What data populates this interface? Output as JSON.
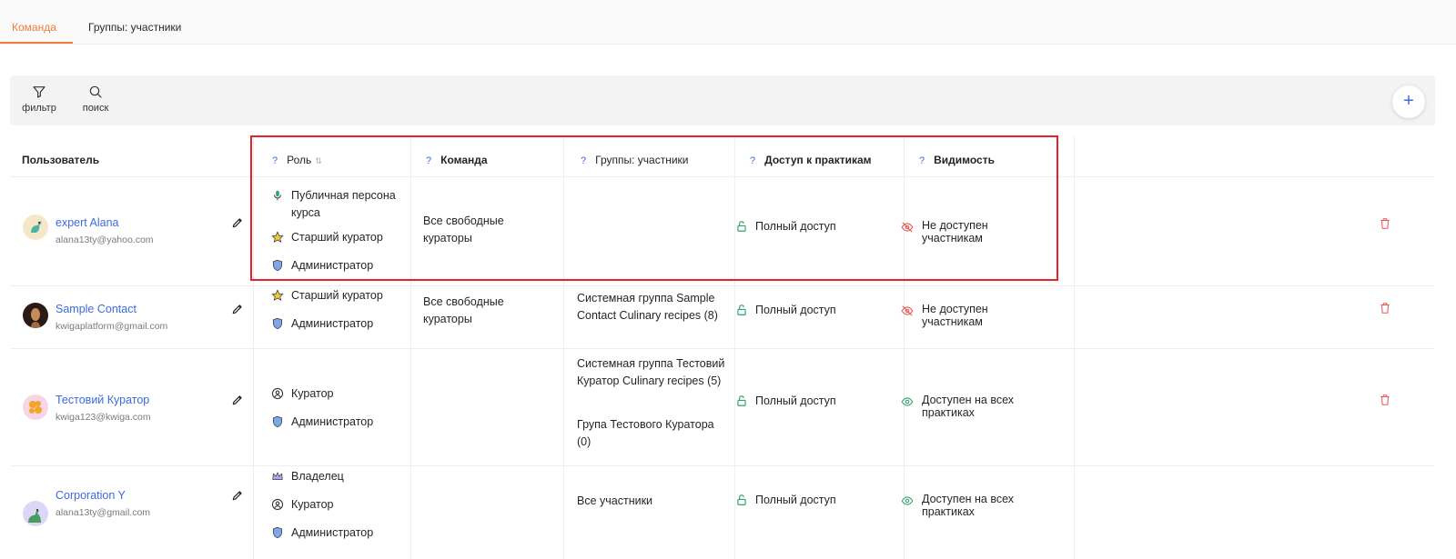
{
  "tabs": [
    {
      "label": "Команда",
      "active": true
    },
    {
      "label": "Группы: участники",
      "active": false
    }
  ],
  "toolbar": {
    "filter_label": "фильтр",
    "search_label": "поиск",
    "add_label": "+"
  },
  "table": {
    "headers": {
      "user": "Пользователь",
      "role": "Роль",
      "team": "Команда",
      "groups": "Группы: участники",
      "access": "Доступ к практикам",
      "visibility": "Видимость",
      "help": "?"
    },
    "rows": [
      {
        "name": "expert Alana",
        "email": "alana13ty@yahoo.com",
        "roles": [
          {
            "icon": "microphone-icon",
            "label": "Публичная персона курса"
          },
          {
            "icon": "star-icon",
            "label": "Старший куратор"
          },
          {
            "icon": "shield-icon",
            "label": "Администратор"
          }
        ],
        "team": "Все свободные кураторы",
        "groups": [],
        "access": "Полный доступ",
        "visibility": "Не доступен участникам",
        "visibility_icon": "eye-off-icon"
      },
      {
        "name": "Sample Contact",
        "email": "kwigaplatform@gmail.com",
        "roles": [
          {
            "icon": "star-icon",
            "label": "Старший куратор"
          },
          {
            "icon": "shield-icon",
            "label": "Администратор"
          }
        ],
        "team": "Все свободные кураторы",
        "groups": [
          "Системная группа Sample Contact Culinary recipes (8)"
        ],
        "access": "Полный доступ",
        "visibility": "Не доступен участникам",
        "visibility_icon": "eye-off-icon"
      },
      {
        "name": "Тестовий Куратор",
        "email": "kwiga123@kwiga.com",
        "roles": [
          {
            "icon": "user-circle-icon",
            "label": "Куратор"
          },
          {
            "icon": "shield-icon",
            "label": "Администратор"
          }
        ],
        "team": "",
        "groups": [
          "Системная группа Тестовий Куратор Culinary recipes (5)",
          "Група Тестового Куратора (0)"
        ],
        "access": "Полный доступ",
        "visibility": "Доступен на всех практиках",
        "visibility_icon": "eye-icon"
      },
      {
        "name": "Corporation Y",
        "email": "alana13ty@gmail.com",
        "roles": [
          {
            "icon": "crown-icon",
            "label": "Владелец"
          },
          {
            "icon": "user-circle-icon",
            "label": "Куратор"
          },
          {
            "icon": "shield-icon",
            "label": "Администратор"
          }
        ],
        "team": "",
        "groups": [
          "Все участники"
        ],
        "access": "Полный доступ",
        "visibility": "Доступен на всех практиках",
        "visibility_icon": "eye-icon"
      }
    ]
  },
  "colors": {
    "accent_orange": "#f07b3f",
    "link_blue": "#3b6be0",
    "access_green": "#2fa36b",
    "danger_red": "#e25b5b",
    "highlight_red": "#e0262a"
  }
}
